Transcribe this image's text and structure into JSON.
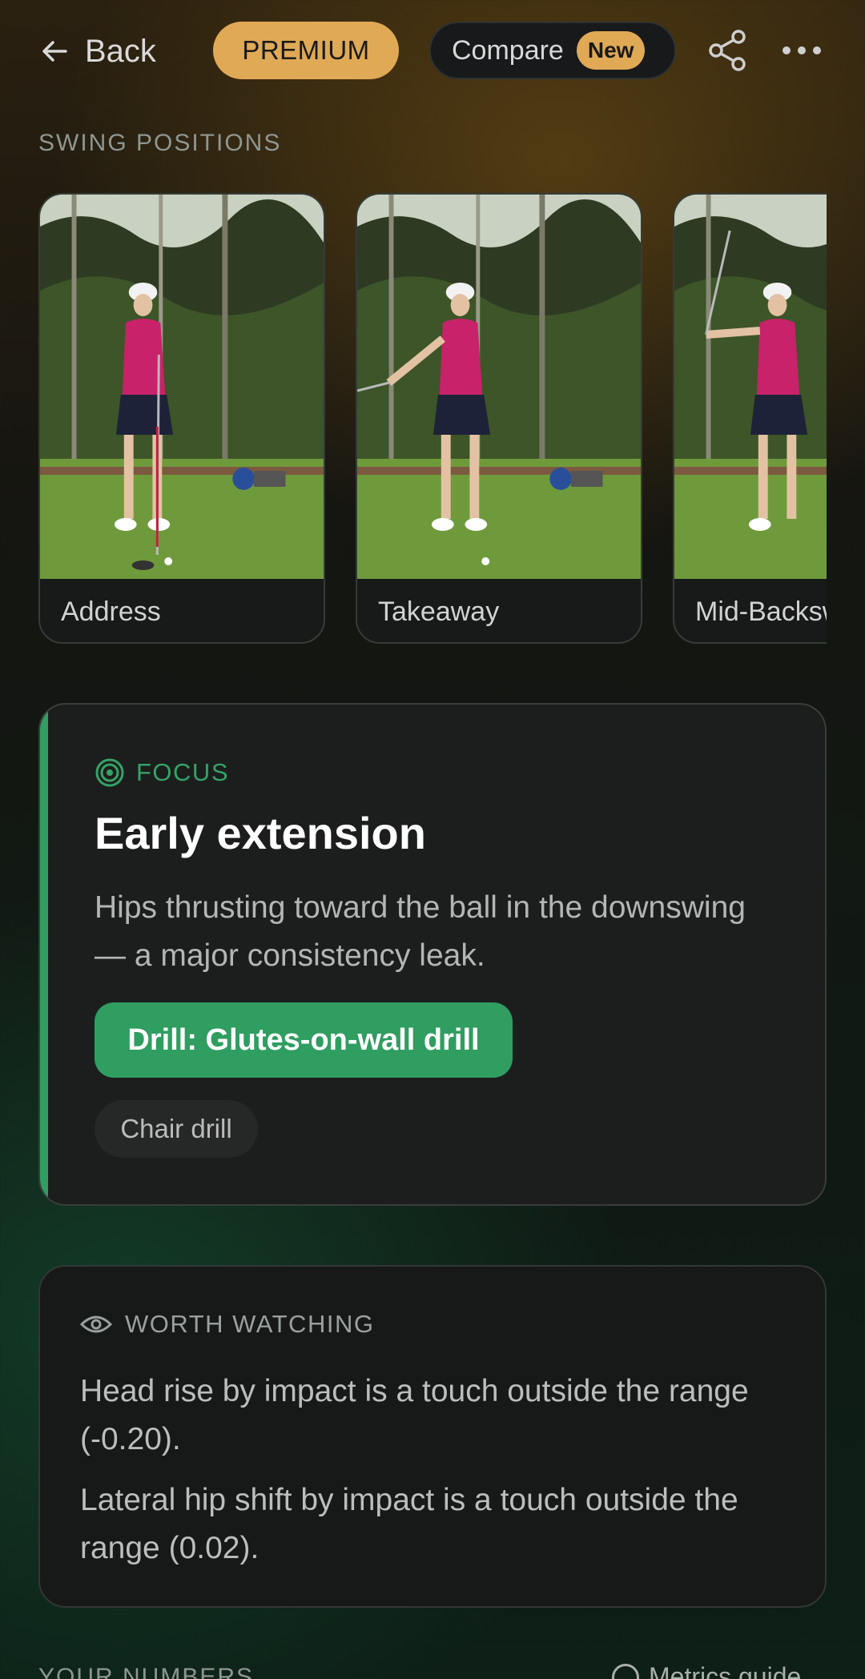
{
  "header": {
    "back_label": "Back",
    "premium_label": "PREMIUM",
    "compare_label": "Compare",
    "compare_badge": "New"
  },
  "swing_positions": {
    "section_label": "SWING POSITIONS",
    "items": [
      {
        "label": "Address"
      },
      {
        "label": "Takeaway"
      },
      {
        "label": "Mid-Backswing"
      }
    ]
  },
  "focus": {
    "tag": "FOCUS",
    "title": "Early extension",
    "description": "Hips thrusting toward the ball in the downswing — a major consistency leak.",
    "drill_button": "Drill: Glutes-on-wall drill",
    "chip": "Chair drill",
    "accent_color": "#2f9e60"
  },
  "worth_watching": {
    "tag": "WORTH WATCHING",
    "lines": [
      "Head rise by impact is a touch outside the range (-0.20).",
      "Lateral hip shift by impact is a touch outside the range (0.02)."
    ]
  },
  "numbers": {
    "section_label": "YOUR NUMBERS",
    "metrics_link": "Metrics guide"
  },
  "colors": {
    "premium": "#e0a955",
    "green": "#2f9e60"
  }
}
